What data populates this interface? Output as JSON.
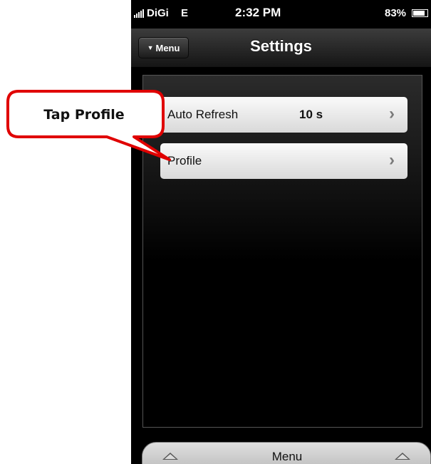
{
  "status_bar": {
    "carrier": "DiGi",
    "network": "E",
    "time": "2:32 PM",
    "battery_percent": "83%",
    "battery_level": 0.83
  },
  "nav_bar": {
    "menu_button_label": "Menu",
    "title": "Settings"
  },
  "settings": [
    {
      "label": "Auto Refresh",
      "value": "10 s"
    },
    {
      "label": "Profile",
      "value": ""
    }
  ],
  "bottom_bar": {
    "label": "Menu"
  },
  "callout": {
    "text": "Tap Profile",
    "border_color": "#e00000"
  },
  "icons": {
    "signal": "signal-bars-icon",
    "battery": "battery-icon",
    "menu_caret": "caret-down-icon",
    "row_chevron": "chevron-right-icon",
    "bottom_arrows": "arrow-up-icon"
  }
}
